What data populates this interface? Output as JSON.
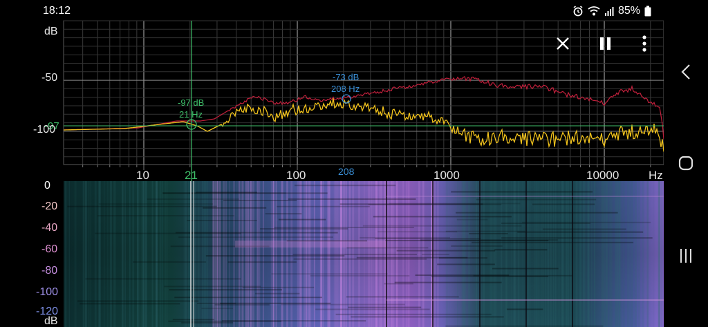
{
  "status_bar": {
    "time": "18:12",
    "battery": "85%"
  },
  "spectrum": {
    "y_unit": "dB",
    "y_ticks": [
      {
        "value": -50,
        "label": "-50"
      },
      {
        "value": -100,
        "label": "-100"
      }
    ],
    "x_unit": "Hz",
    "x_ticks": [
      {
        "value": 10,
        "label": "10"
      },
      {
        "value": 100,
        "label": "100"
      },
      {
        "value": 1000,
        "label": "1000"
      },
      {
        "value": 10000,
        "label": "10000"
      }
    ],
    "cursor_green": {
      "freq_label": "21",
      "level_line_label": "-97",
      "readout_db": "-97 dB",
      "readout_hz": "21 Hz",
      "color": "#3fbf6a"
    },
    "cursor_blue": {
      "freq_label": "208",
      "readout_db": "-73 dB",
      "readout_hz": "208 Hz",
      "color": "#3a8fd6"
    },
    "peak_trace_color": "#c2203c",
    "live_trace_color": "#f2c31c"
  },
  "spectrogram": {
    "y_unit": "dB",
    "y_labels": [
      "0",
      "-20",
      "-40",
      "-60",
      "-80",
      "-100",
      "-120"
    ],
    "label_colors": [
      "#ffffff",
      "#f3c7c7",
      "#e8a7c4",
      "#dd8fd0",
      "#c58ee0",
      "#9d8fe6",
      "#7d8fe6"
    ]
  },
  "toolbar": {
    "icons": [
      "close-icon",
      "pause-icon",
      "more-vert-icon"
    ]
  },
  "navbar": {
    "icons": [
      "back-icon",
      "home-icon",
      "recents-icon"
    ]
  }
}
